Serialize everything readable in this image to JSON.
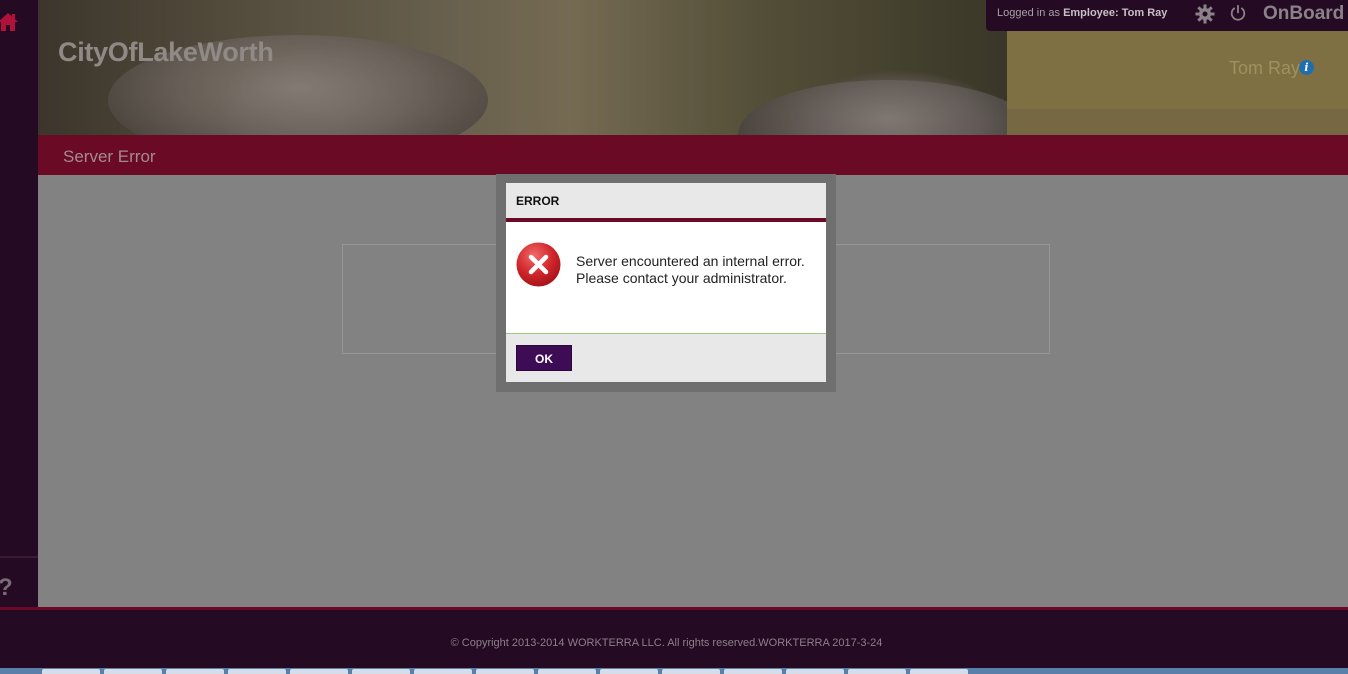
{
  "header": {
    "org_title": "CityOfLakeWorth",
    "user_display_name": "Tom Ray",
    "logged_in_prefix": "Logged in as",
    "logged_in_role": "Employee:",
    "logged_in_user": "Tom Ray",
    "app_name": "OnBoard"
  },
  "page": {
    "title": "Server Error"
  },
  "dialog": {
    "title": "ERROR",
    "message": "Server encountered an internal error. Please contact your administrator.",
    "ok_label": "OK"
  },
  "sidebar": {
    "help_label": "?"
  },
  "footer": {
    "copyright": "© Copyright 2013-2014 WORKTERRA LLC. All rights reserved.WORKTERRA 2017-3-24"
  },
  "icons": [
    "home-icon",
    "help-icon",
    "gear-icon",
    "power-icon",
    "info-icon",
    "error-icon"
  ],
  "colors": {
    "brand_crimson": "#6a0a24",
    "dark_plum": "#240a23",
    "ok_button": "#3e0c55",
    "error_red": "#d0262b"
  }
}
